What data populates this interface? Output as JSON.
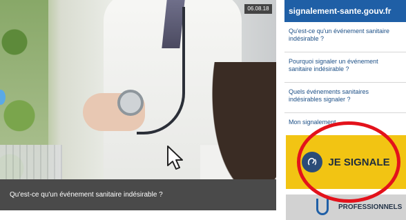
{
  "video": {
    "date": "06.08.18",
    "caption": "Qu'est-ce qu'un événement sanitaire indésirable ?"
  },
  "panel": {
    "title": "signalement-sante.gouv.fr",
    "menu": [
      {
        "label": "Qu'est-ce qu'un événement sanitaire indésirable ?"
      },
      {
        "label": "Pourquoi signaler un événement sanitaire indésirable ?"
      },
      {
        "label": "Quels événements sanitaires indésirables signaler ?"
      },
      {
        "label": "Mon signalement"
      }
    ],
    "signale_button": "JE SIGNALE",
    "pro_label": "PROFESSIONNELS"
  },
  "colors": {
    "header": "#1f5fa6",
    "signale_bg": "#f2c413",
    "highlight": "#e3121b"
  },
  "icons": [
    "play-icon",
    "cursor-icon",
    "ear-sound-icon",
    "stethoscope-icon"
  ]
}
